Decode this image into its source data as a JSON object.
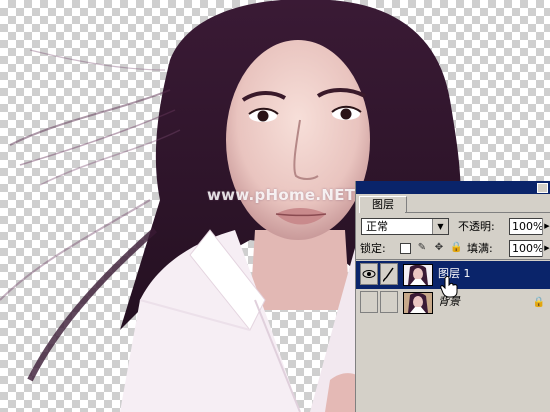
{
  "watermark": "www.pHome.NET",
  "layers_panel": {
    "tab_label": "图层",
    "blend_mode": "正常",
    "opacity_label": "不透明:",
    "opacity_value": "100%",
    "lock_label": "锁定:",
    "fill_label": "填满:",
    "fill_value": "100%",
    "layers": [
      {
        "name": "图层 1",
        "selected": true,
        "visible": true
      },
      {
        "name": "背景",
        "selected": false,
        "visible": false
      }
    ]
  },
  "icons": [
    "eye-icon",
    "brush-icon",
    "lock-icon",
    "move-icon",
    "transparency-lock-icon",
    "hand-cursor-icon",
    "dropdown-arrow-icon"
  ],
  "colors": {
    "titlebar": "#0a246a",
    "selected_layer": "#0a246a",
    "panel_bg": "#d4d0c8"
  }
}
